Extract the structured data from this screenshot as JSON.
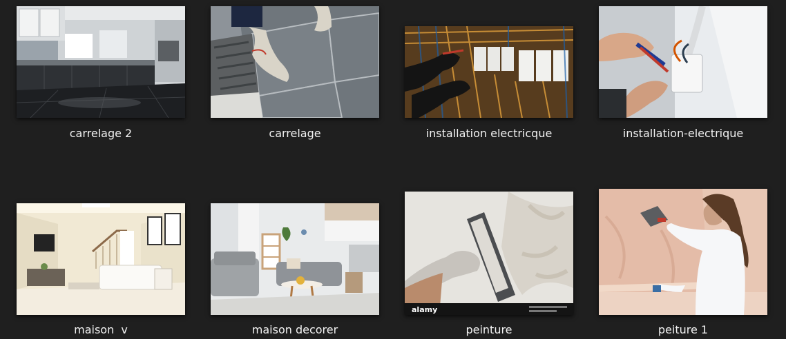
{
  "files": [
    {
      "name": "carrelage 2",
      "icon": "kitchen-tile-photo-icon"
    },
    {
      "name": "carrelage",
      "icon": "tiling-hands-photo-icon"
    },
    {
      "name": "installation electricque",
      "icon": "electric-panel-photo-icon"
    },
    {
      "name": "installation-electrique",
      "icon": "wiring-hands-photo-icon"
    },
    {
      "name": "maison  v",
      "icon": "living-room-photo-icon"
    },
    {
      "name": "maison decorer",
      "icon": "decorated-room-photo-icon"
    },
    {
      "name": "peinture",
      "icon": "plaster-trowel-photo-icon",
      "watermark": "alamy"
    },
    {
      "name": "peiture 1",
      "icon": "woman-plastering-photo-icon"
    }
  ],
  "colors": {
    "background": "#1f1f1f",
    "caption": "#f2f2f2"
  }
}
